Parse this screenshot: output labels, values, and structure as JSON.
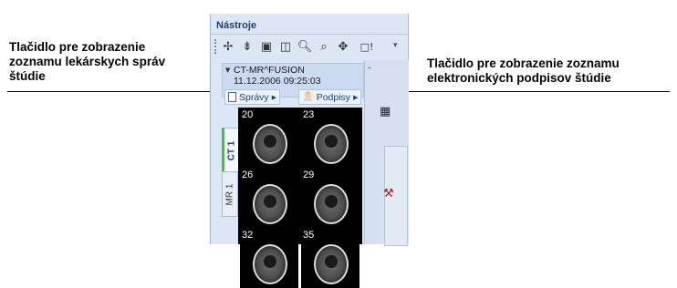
{
  "panel": {
    "title": "Nástroje"
  },
  "toolbar": {
    "buttons": [
      {
        "icon": "crosshair-icon",
        "glyph": "✢"
      },
      {
        "icon": "measure-icon",
        "glyph": "⇟"
      },
      {
        "icon": "overlay-icon",
        "glyph": "▣"
      },
      {
        "icon": "split-icon",
        "glyph": "◫"
      },
      {
        "icon": "zoom-icon",
        "glyph": "🔍︎"
      },
      {
        "icon": "magnify-icon",
        "glyph": "⌕"
      },
      {
        "icon": "pan-icon",
        "glyph": "✥"
      },
      {
        "icon": "window-icon",
        "glyph": "□!"
      }
    ],
    "overflow_glyph": "▾"
  },
  "study": {
    "expander_glyph": "▼",
    "name": "CT-MR^FUSION",
    "date": "11.12.2006 09:25:03",
    "reports_label": "Správy",
    "signatures_label": "Podpisy",
    "submenu_glyph": "▶",
    "scroll_glyph": "⌃"
  },
  "series_tabs": [
    {
      "label": "CT 1",
      "active": true
    },
    {
      "label": "MR 1",
      "active": false
    }
  ],
  "thumbnails": [
    "20",
    "23",
    "26",
    "29",
    "32",
    "35"
  ],
  "right_strip": {
    "icon_1_glyph": "▦",
    "icon_2_glyph": "⚒"
  },
  "callouts": {
    "left": [
      "Tlačidlo pre zobrazenie",
      "zoznamu lekárskych správ",
      "štúdie"
    ],
    "right": [
      "Tlačidlo pre zobrazenie zoznamu",
      "elektronických podpisov štúdie"
    ]
  },
  "colors": {
    "panel_bg": "#dce7f5",
    "active_tab_accent": "#38c838",
    "signature_icon": "#e07a00",
    "text_link": "#1a3e8c"
  }
}
